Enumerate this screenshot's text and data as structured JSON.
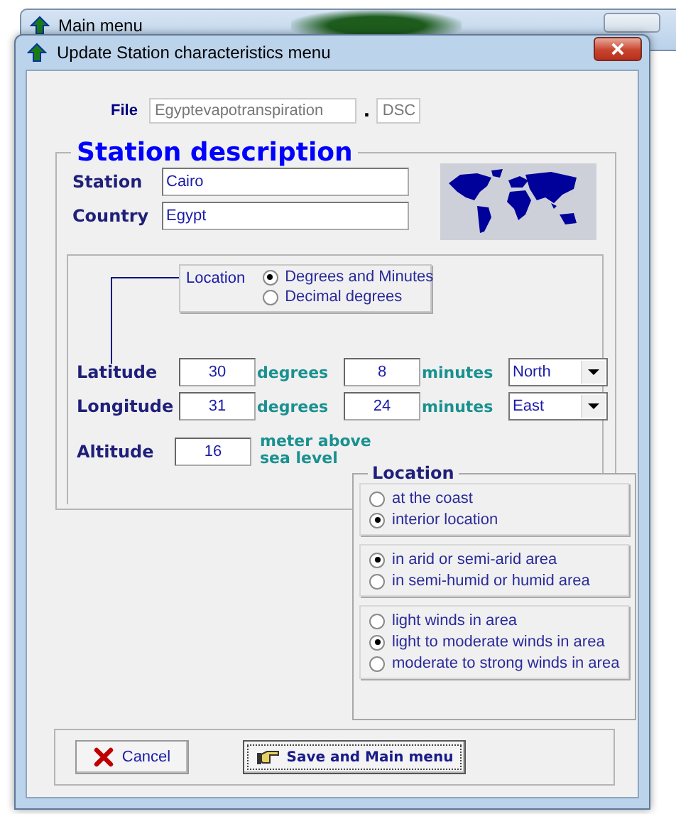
{
  "background_window": {
    "title": "Main menu"
  },
  "window": {
    "title": "Update Station characteristics menu"
  },
  "file": {
    "label": "File",
    "name": "Egyptevapotranspiration",
    "separator": ".",
    "extension": "DSC"
  },
  "station_description": {
    "title": "Station description",
    "station_label": "Station",
    "station": "Cairo",
    "country_label": "Country",
    "country": "Egypt"
  },
  "coordinates": {
    "location_label": "Location",
    "format_options": [
      {
        "label": "Degrees and Minutes",
        "selected": true
      },
      {
        "label": "Decimal degrees",
        "selected": false
      }
    ],
    "rows": [
      {
        "label": "Latitude",
        "degrees": "30",
        "degrees_unit": "degrees",
        "minutes": "8",
        "minutes_unit": "minutes",
        "direction": "North"
      },
      {
        "label": "Longitude",
        "degrees": "31",
        "degrees_unit": "degrees",
        "minutes": "24",
        "minutes_unit": "minutes",
        "direction": "East"
      }
    ],
    "altitude": {
      "label": "Altitude",
      "value": "16",
      "unit": "meter above sea level"
    }
  },
  "location_panel": {
    "title": "Location",
    "groups": [
      {
        "options": [
          {
            "label": "at the coast",
            "selected": false
          },
          {
            "label": "interior location",
            "selected": true
          }
        ]
      },
      {
        "options": [
          {
            "label": "in arid or semi-arid area",
            "selected": true
          },
          {
            "label": "in semi-humid or humid area",
            "selected": false
          }
        ]
      },
      {
        "options": [
          {
            "label": "light winds in area",
            "selected": false
          },
          {
            "label": "light to moderate winds in area",
            "selected": true
          },
          {
            "label": "moderate to strong winds in area",
            "selected": false
          }
        ]
      }
    ]
  },
  "buttons": [
    {
      "label": "Cancel",
      "kind": "cancel",
      "focused": false
    },
    {
      "label": "Save and Main menu",
      "kind": "save",
      "focused": true
    }
  ]
}
